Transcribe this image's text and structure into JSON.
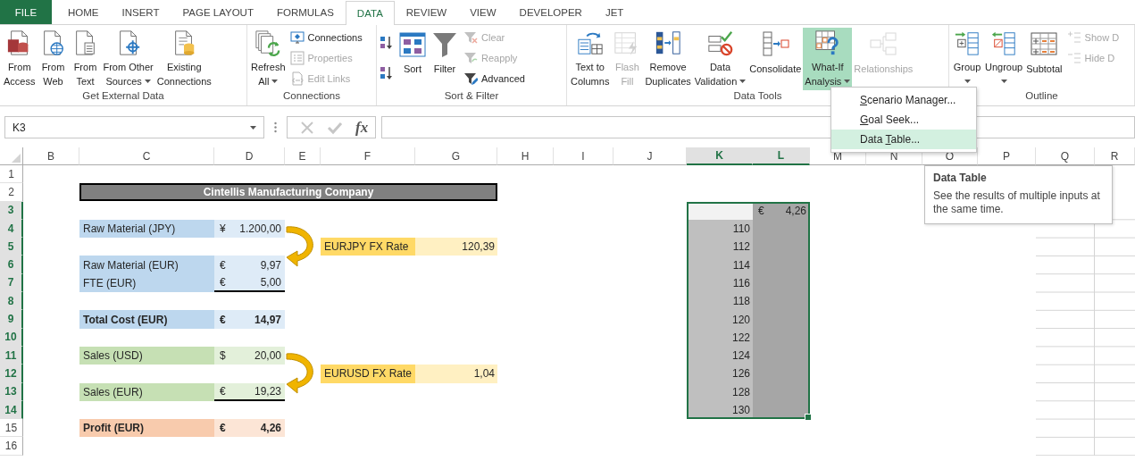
{
  "ribbon_tabs": [
    {
      "label": "FILE",
      "kind": "file",
      "selected": false
    },
    {
      "label": "HOME",
      "kind": "tab",
      "selected": false
    },
    {
      "label": "INSERT",
      "kind": "tab",
      "selected": false
    },
    {
      "label": "PAGE LAYOUT",
      "kind": "tab",
      "selected": false
    },
    {
      "label": "FORMULAS",
      "kind": "tab",
      "selected": false
    },
    {
      "label": "DATA",
      "kind": "tab",
      "selected": true
    },
    {
      "label": "REVIEW",
      "kind": "tab",
      "selected": false
    },
    {
      "label": "VIEW",
      "kind": "tab",
      "selected": false
    },
    {
      "label": "DEVELOPER",
      "kind": "tab",
      "selected": false
    },
    {
      "label": "JET",
      "kind": "tab",
      "selected": false
    }
  ],
  "ribbon_groups": [
    {
      "label": "Get External Data",
      "items": [
        {
          "kind": "large",
          "lines": [
            "From",
            "Access"
          ],
          "dropdown": false,
          "disabled": false,
          "pressed": false
        },
        {
          "kind": "large",
          "lines": [
            "From",
            "Web"
          ],
          "dropdown": false,
          "disabled": false,
          "pressed": false
        },
        {
          "kind": "large",
          "lines": [
            "From",
            "Text"
          ],
          "dropdown": false,
          "disabled": false,
          "pressed": false
        },
        {
          "kind": "large",
          "lines": [
            "From Other",
            "Sources"
          ],
          "dropdown": true,
          "disabled": false,
          "pressed": false
        },
        {
          "kind": "large",
          "lines": [
            "Existing",
            "Connections"
          ],
          "dropdown": false,
          "disabled": false,
          "pressed": false
        }
      ]
    },
    {
      "label": "Connections",
      "items": [
        {
          "kind": "large",
          "lines": [
            "Refresh",
            "All"
          ],
          "dropdown": true,
          "disabled": false,
          "pressed": false
        },
        {
          "kind": "stack",
          "buttons": [
            {
              "label": "Connections",
              "disabled": false
            },
            {
              "label": "Properties",
              "disabled": true
            },
            {
              "label": "Edit Links",
              "disabled": true
            }
          ]
        }
      ]
    },
    {
      "label": "Sort & Filter",
      "items": [
        {
          "kind": "sort_pair"
        },
        {
          "kind": "large",
          "lines": [
            "Sort"
          ],
          "dropdown": false,
          "disabled": false,
          "pressed": false
        },
        {
          "kind": "large",
          "lines": [
            "Filter"
          ],
          "dropdown": false,
          "disabled": false,
          "pressed": false
        },
        {
          "kind": "stack",
          "buttons": [
            {
              "label": "Clear",
              "disabled": true
            },
            {
              "label": "Reapply",
              "disabled": true
            },
            {
              "label": "Advanced",
              "disabled": false
            }
          ]
        }
      ]
    },
    {
      "label": "Data Tools",
      "items": [
        {
          "kind": "large",
          "lines": [
            "Text to",
            "Columns"
          ],
          "dropdown": false,
          "disabled": false,
          "pressed": false
        },
        {
          "kind": "large",
          "lines": [
            "Flash",
            "Fill"
          ],
          "dropdown": false,
          "disabled": true,
          "pressed": false
        },
        {
          "kind": "large",
          "lines": [
            "Remove",
            "Duplicates"
          ],
          "dropdown": false,
          "disabled": false,
          "pressed": false
        },
        {
          "kind": "large",
          "lines": [
            "Data",
            "Validation"
          ],
          "dropdown": true,
          "disabled": false,
          "pressed": false
        },
        {
          "kind": "large",
          "lines": [
            "Consolidate"
          ],
          "dropdown": false,
          "disabled": false,
          "pressed": false
        },
        {
          "kind": "large",
          "lines": [
            "What-If",
            "Analysis"
          ],
          "dropdown": true,
          "disabled": false,
          "pressed": true
        },
        {
          "kind": "large",
          "lines": [
            "Relationships"
          ],
          "dropdown": false,
          "disabled": true,
          "pressed": false
        }
      ]
    },
    {
      "label": "Outline",
      "items": [
        {
          "kind": "large",
          "lines": [
            "Group"
          ],
          "dropdown": true,
          "disabled": false,
          "pressed": false
        },
        {
          "kind": "large",
          "lines": [
            "Ungroup"
          ],
          "dropdown": true,
          "disabled": false,
          "pressed": false
        },
        {
          "kind": "large",
          "lines": [
            "Subtotal"
          ],
          "dropdown": false,
          "disabled": false,
          "pressed": false
        },
        {
          "kind": "stack",
          "buttons": [
            {
              "label": "Show D",
              "disabled": true
            },
            {
              "label": "Hide D",
              "disabled": true
            }
          ]
        }
      ]
    }
  ],
  "what_if_menu": [
    {
      "key": "S",
      "after": "cenario Manager...",
      "selected": false
    },
    {
      "key": "G",
      "after": "oal Seek...",
      "selected": false
    },
    {
      "before": "Data ",
      "key": "T",
      "after": "able...",
      "selected": true
    }
  ],
  "tooltip": {
    "title": "Data Table",
    "text": "See the results of multiple inputs at the same time."
  },
  "formula_bar": {
    "name_box": "K3",
    "function_button": "fx"
  },
  "columns": [
    {
      "label": "B",
      "selected": false
    },
    {
      "label": "C",
      "selected": false
    },
    {
      "label": "D",
      "selected": false
    },
    {
      "label": "E",
      "selected": false
    },
    {
      "label": "F",
      "selected": false
    },
    {
      "label": "G",
      "selected": false
    },
    {
      "label": "H",
      "selected": false
    },
    {
      "label": "I",
      "selected": false
    },
    {
      "label": "J",
      "selected": false
    },
    {
      "label": "K",
      "selected": true
    },
    {
      "label": "L",
      "selected": true
    },
    {
      "label": "M",
      "selected": false
    },
    {
      "label": "N",
      "selected": false
    },
    {
      "label": "O",
      "selected": false
    },
    {
      "label": "P",
      "selected": false
    },
    {
      "label": "Q",
      "selected": false
    },
    {
      "label": "R",
      "selected": false
    }
  ],
  "rows": [
    {
      "label": "1",
      "selected": false
    },
    {
      "label": "2",
      "selected": false
    },
    {
      "label": "3",
      "selected": true
    },
    {
      "label": "4",
      "selected": true
    },
    {
      "label": "5",
      "selected": true
    },
    {
      "label": "6",
      "selected": true
    },
    {
      "label": "7",
      "selected": true
    },
    {
      "label": "8",
      "selected": true
    },
    {
      "label": "9",
      "selected": true
    },
    {
      "label": "10",
      "selected": true
    },
    {
      "label": "11",
      "selected": true
    },
    {
      "label": "12",
      "selected": true
    },
    {
      "label": "13",
      "selected": true
    },
    {
      "label": "14",
      "selected": true
    },
    {
      "label": "15",
      "selected": false
    },
    {
      "label": "16",
      "selected": false
    }
  ],
  "sheet_title": "Cintellis Manufacturing Company",
  "line_items": [
    {
      "label": "Raw Material (JPY)",
      "symbol": "¥",
      "value": "1.200,00",
      "color": "#bdd7ee",
      "bold": false,
      "underlined": false
    },
    {
      "label": "Raw Material (EUR)",
      "symbol": "€",
      "value": "9,97",
      "color": "#bdd7ee",
      "bold": false,
      "underlined": false
    },
    {
      "label": "FTE (EUR)",
      "symbol": "€",
      "value": "5,00",
      "color": "#bdd7ee",
      "bold": false,
      "underlined": true
    },
    {
      "label": "Total Cost (EUR)",
      "symbol": "€",
      "value": "14,97",
      "color": "#bdd7ee",
      "bold": true,
      "underlined": false
    },
    {
      "label": "Sales (USD)",
      "symbol": "$",
      "value": "20,00",
      "color": "#c6e0b4",
      "bold": false,
      "underlined": false
    },
    {
      "label": "Sales (EUR)",
      "symbol": "€",
      "value": "19,23",
      "color": "#c6e0b4",
      "bold": false,
      "underlined": true
    },
    {
      "label": "Profit (EUR)",
      "symbol": "€",
      "value": "4,26",
      "color": "#f8cbad",
      "bold": true,
      "underlined": false
    }
  ],
  "fx_rates": [
    {
      "label": "EURJPY FX Rate",
      "value": "120,39",
      "color": "#ffd966"
    },
    {
      "label": "EURUSD FX Rate",
      "value": "1,04",
      "color": "#ffd966"
    }
  ],
  "data_table": {
    "selected": true,
    "result_symbol": "€",
    "result": "4,26",
    "inputs": [
      "110",
      "112",
      "114",
      "116",
      "118",
      "120",
      "122",
      "124",
      "126",
      "128",
      "130"
    ]
  }
}
